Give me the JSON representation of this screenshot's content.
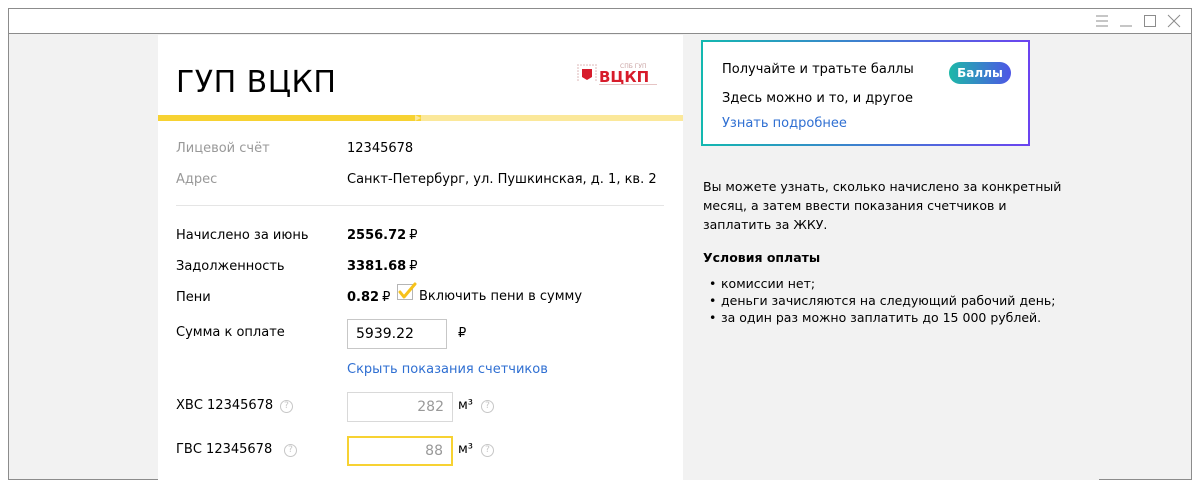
{
  "company": {
    "title": "ГУП ВЦКП",
    "logo_text_top": "СПБ ГУП",
    "logo_text_main": "ВЦКП"
  },
  "progress": {
    "fraction": 0.5
  },
  "account": {
    "account_label": "Лицевой счёт",
    "account_value": "12345678",
    "address_label": "Адрес",
    "address_value": "Санкт-Петербург, ул. Пушкинская, д. 1, кв. 2"
  },
  "charges": {
    "charged_label": "Начислено за июнь",
    "charged_value": "2556.72",
    "debt_label": "Задолженность",
    "debt_value": "3381.68",
    "penalty_label": "Пени",
    "penalty_value": "0.82",
    "include_penalty_label": "Включить пени в сумму",
    "include_penalty_checked": true,
    "currency": "₽",
    "total_label": "Сумма к оплате",
    "total_value": "5939.22",
    "hide_meters_link": "Скрыть показания счетчиков"
  },
  "meters": [
    {
      "label": "ХВС 12345678",
      "value": "282",
      "unit": "м³",
      "help": "?"
    },
    {
      "label": "ГВС 12345678",
      "value": "88",
      "unit": "м³",
      "help": "?"
    }
  ],
  "promo": {
    "title": "Получайте и тратьте баллы",
    "subtitle": "Здесь можно и то, и другое",
    "link": "Узнать подробнее",
    "badge": "Баллы"
  },
  "info": {
    "text": "Вы можете узнать, сколько начислено за конкретный месяц, а затем ввести показания счетчиков и заплатить за ЖКУ.",
    "conditions_title": "Условия оплаты",
    "conditions": [
      "комиссии нет;",
      "деньги зачисляются на следующий рабочий день;",
      "за один раз можно заплатить до 15 000 рублей."
    ]
  },
  "colors": {
    "accent_yellow": "#f7d232",
    "link_blue": "#2f6fd2",
    "promo_gradient_start": "#13b8b0",
    "promo_gradient_end": "#6b44f0"
  },
  "icons": {
    "window_controls": [
      "menu-icon",
      "minimize-icon",
      "maximize-icon",
      "close-icon"
    ],
    "checkmark": "checkmark-icon"
  }
}
